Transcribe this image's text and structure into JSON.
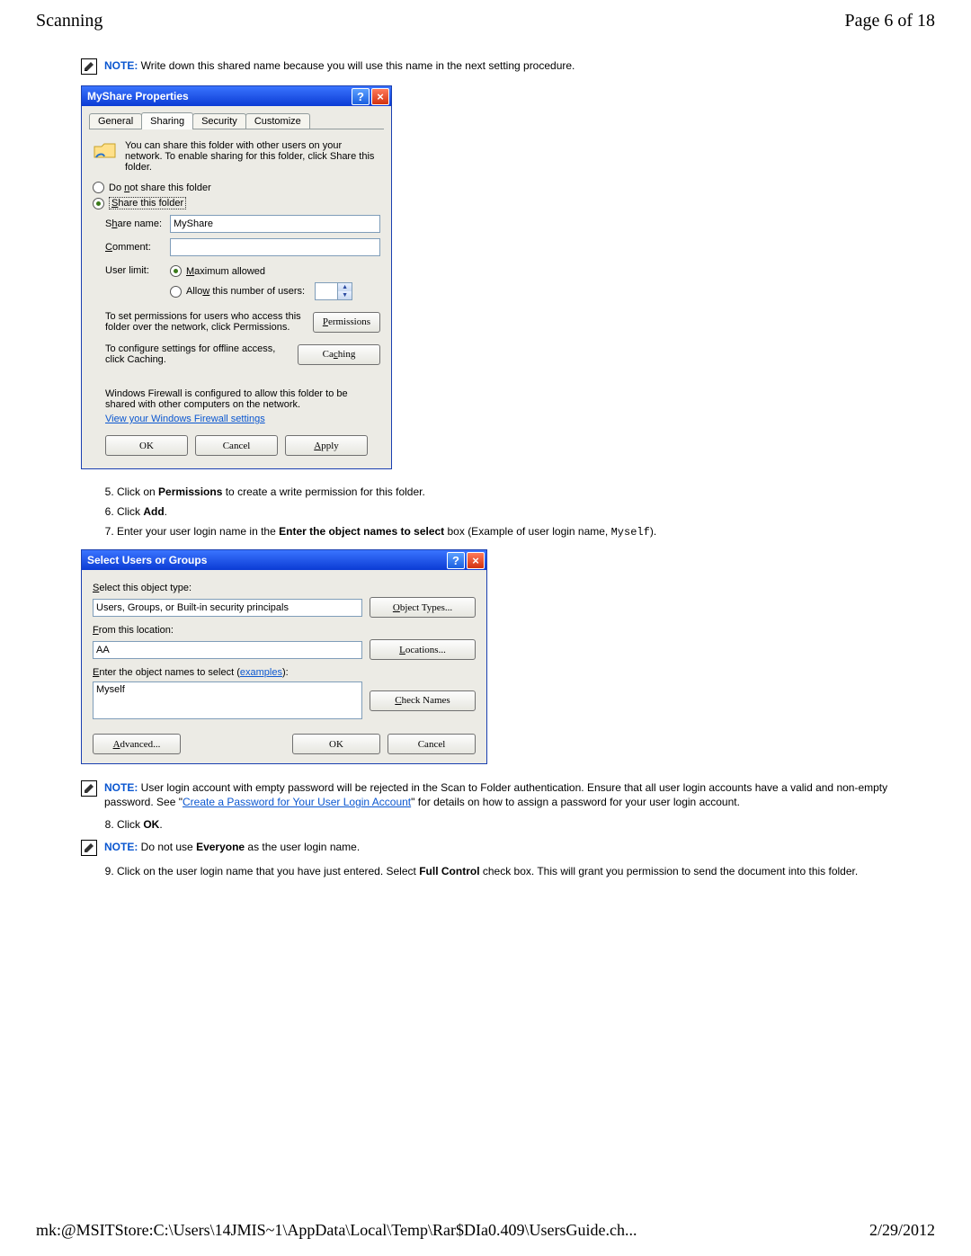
{
  "header": {
    "title": "Scanning",
    "page_indicator": "Page 6 of 18"
  },
  "note1": {
    "label": "NOTE:",
    "text": " Write down this shared name because you will use this name in the next setting procedure."
  },
  "dlg1": {
    "title": "MyShare Properties",
    "tabs": [
      "General",
      "Sharing",
      "Security",
      "Customize"
    ],
    "active_tab": "Sharing",
    "desc": "You can share this folder with other users on your network.  To enable sharing for this folder, click Share this folder.",
    "radio_not_share": "Do not share this folder",
    "radio_share": "Share this folder",
    "share_name_label": "Share name:",
    "share_name_value": "MyShare",
    "comment_label": "Comment:",
    "comment_value": "",
    "user_limit_label": "User limit:",
    "max_allowed": "Maximum allowed",
    "allow_num": "Allow this number of users:",
    "perm_text": "To set permissions for users who access this folder over the network, click Permissions.",
    "perm_btn": "Permissions",
    "cache_text": "To configure settings for offline access, click Caching.",
    "cache_btn": "Caching",
    "firewall_text": "Windows Firewall is configured to allow this folder to be shared with other computers on the network.",
    "firewall_link": "View your Windows Firewall settings",
    "ok": "OK",
    "cancel": "Cancel",
    "apply": "Apply"
  },
  "steps_a": {
    "s5_a": "Click on ",
    "s5_b": "Permissions",
    "s5_c": " to create a write permission for this folder.",
    "s6_a": "Click ",
    "s6_b": "Add",
    "s6_c": ".",
    "s7_a": "Enter your user login name in the ",
    "s7_b": "Enter the object names to select",
    "s7_c": " box (Example of user login name, ",
    "s7_code": "Myself",
    "s7_d": ")."
  },
  "dlg2": {
    "title": "Select Users or Groups",
    "sel_type_lbl": "Select this object type:",
    "sel_type_val": "Users, Groups, or Built-in security principals",
    "obj_types_btn": "Object Types...",
    "from_loc_lbl": "From this location:",
    "from_loc_val": "AA",
    "locations_btn": "Locations...",
    "enter_names_a": "Enter the object names to select (",
    "enter_names_link": "examples",
    "enter_names_b": "):",
    "names_val": "Myself",
    "check_names_btn": "Check Names",
    "advanced_btn": "Advanced...",
    "ok": "OK",
    "cancel": "Cancel"
  },
  "note2": {
    "label": "NOTE:",
    "a": " User login account with empty password will be rejected in the Scan to Folder authentication. Ensure that all user login accounts have a valid and non-empty password. See \"",
    "link": "Create a Password for Your User Login Account",
    "b": "\" for details on how to assign a password for your user login account."
  },
  "steps_b": {
    "s8_a": "Click ",
    "s8_b": "OK",
    "s8_c": "."
  },
  "note3": {
    "label": "NOTE:",
    "a": " Do not use ",
    "b": "Everyone",
    "c": " as the user login name."
  },
  "steps_c": {
    "s9_a": "Click on the user login name that you have just entered. Select ",
    "s9_b": "Full Control",
    "s9_c": " check box. This will grant you permission to send the document into this folder."
  },
  "footer": {
    "path": "mk:@MSITStore:C:\\Users\\14JMIS~1\\AppData\\Local\\Temp\\Rar$DIa0.409\\UsersGuide.ch...",
    "date": "2/29/2012"
  }
}
